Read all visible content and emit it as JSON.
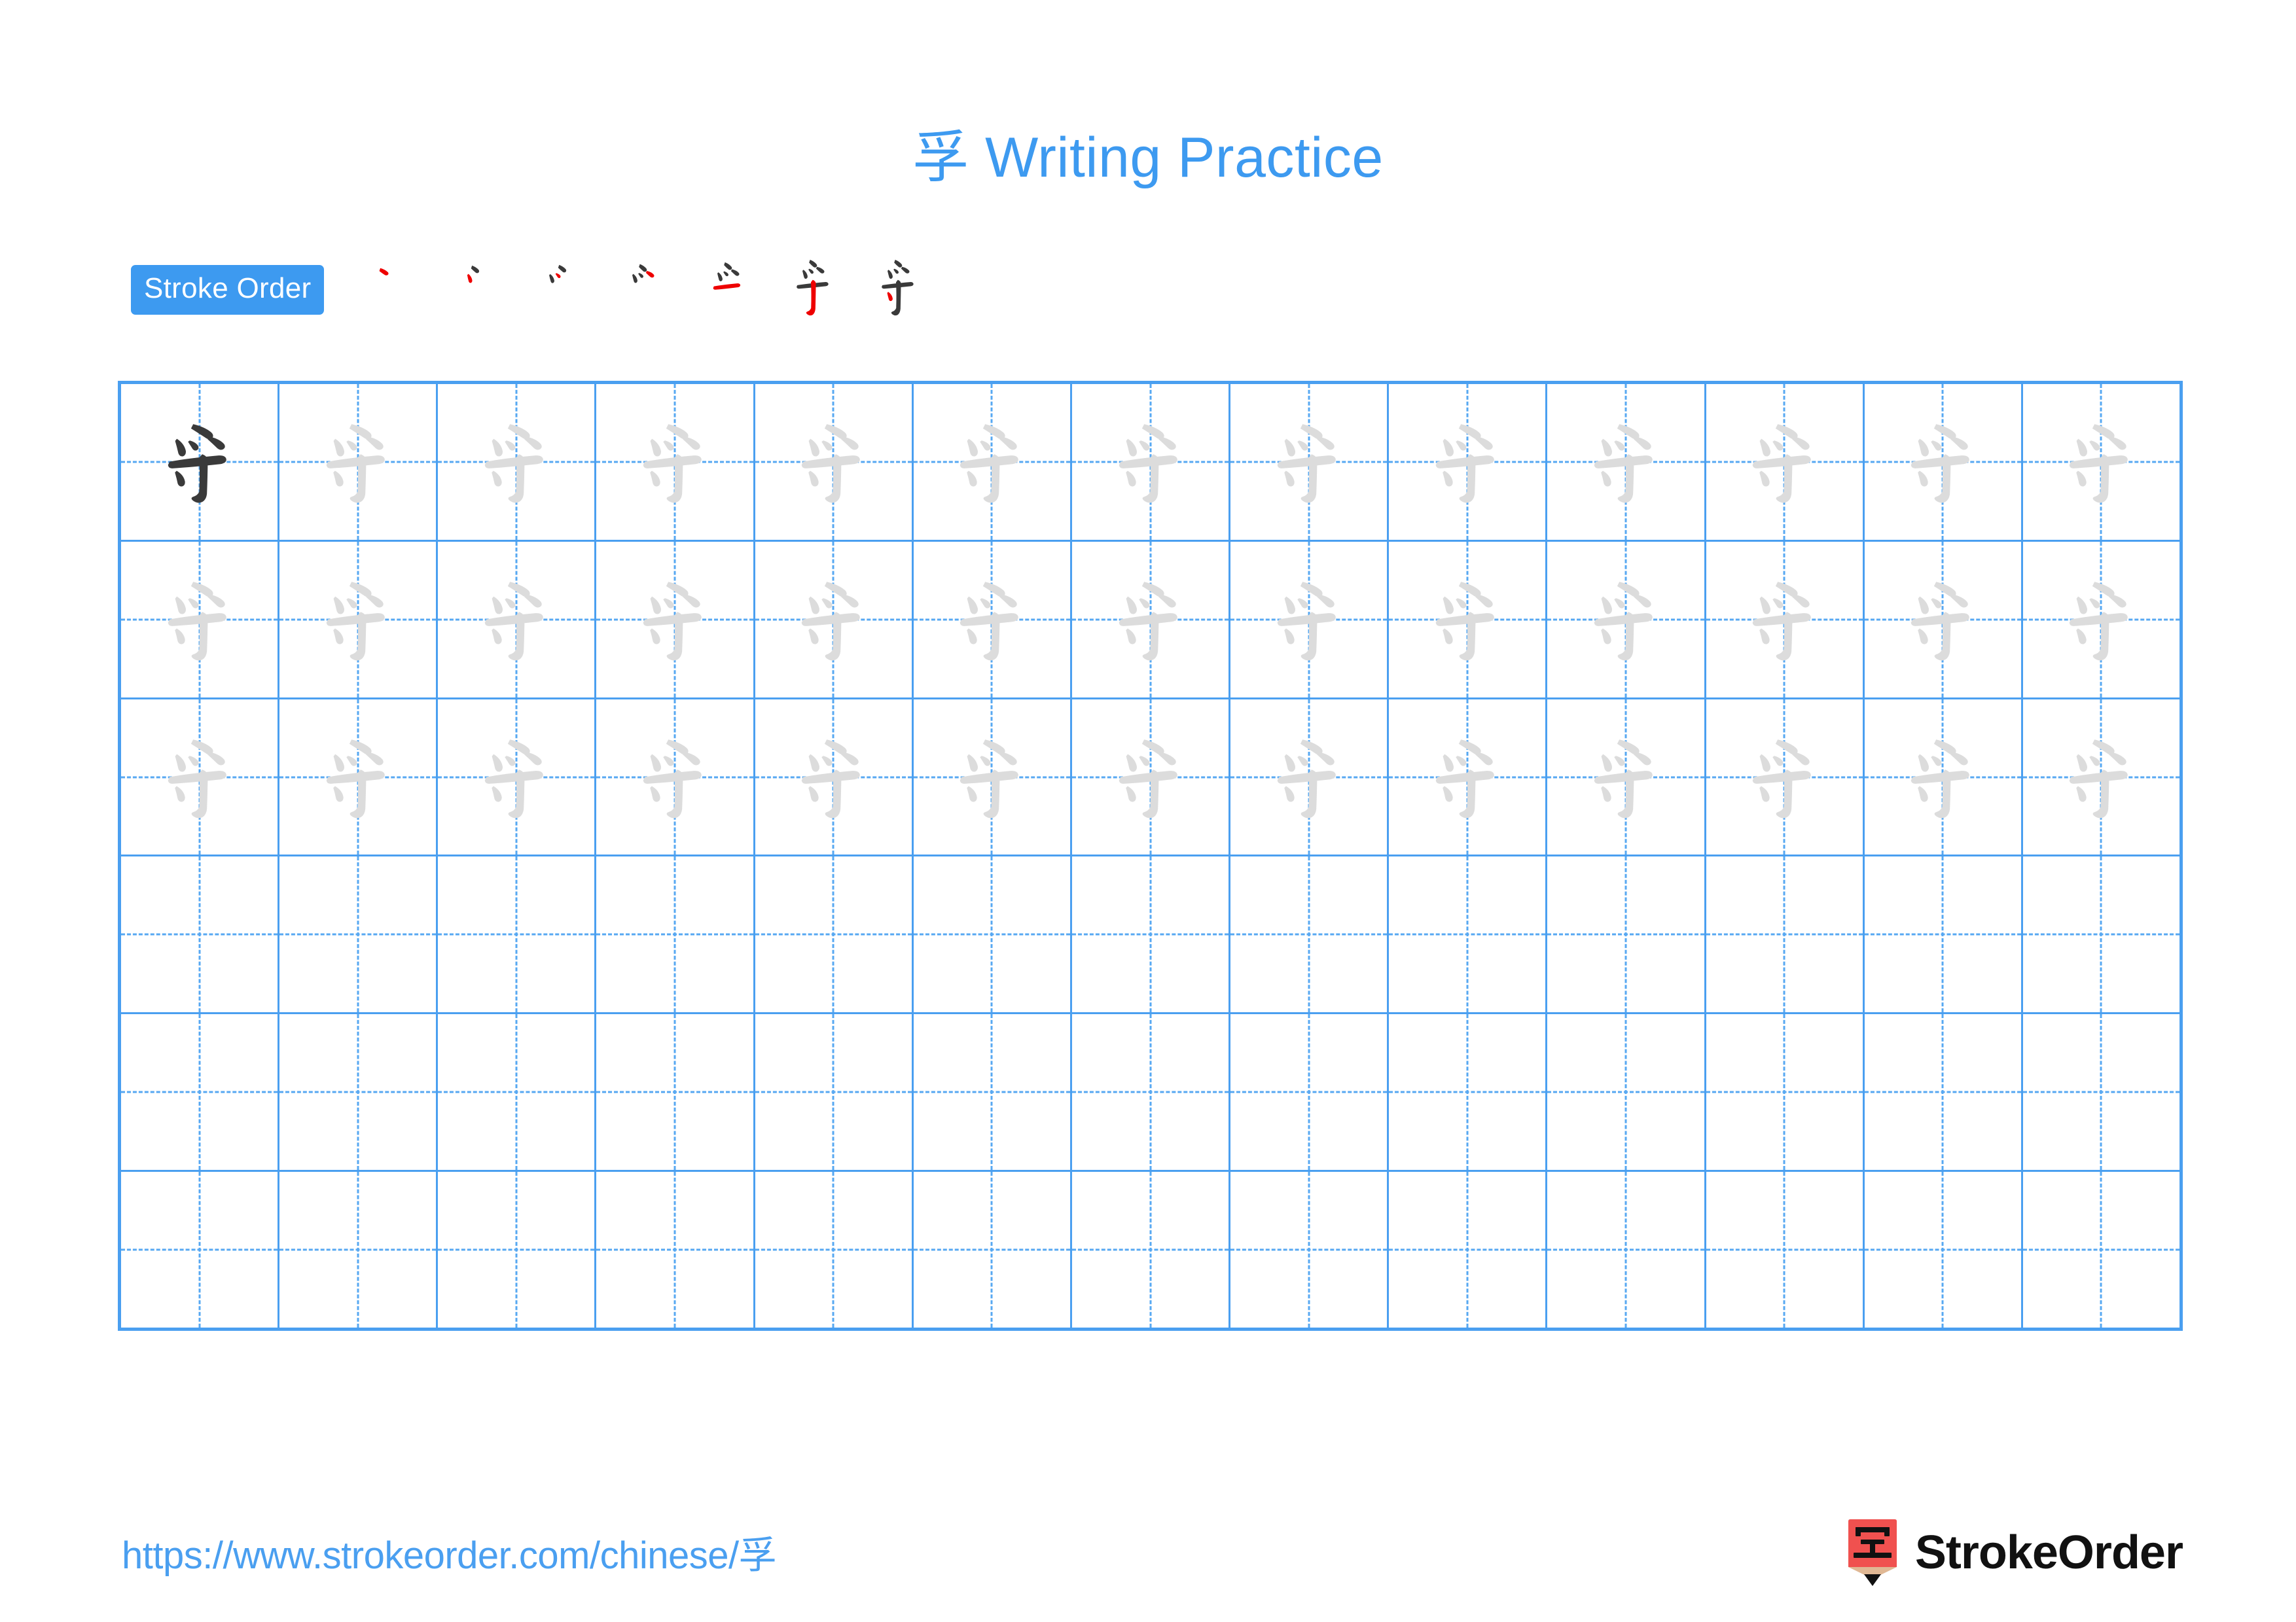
{
  "character": "孚",
  "title": {
    "character": "孚",
    "text": " Writing Practice",
    "full": "孚 Writing Practice",
    "color": "#3D9AF0"
  },
  "stroke_order": {
    "badge_label": "Stroke Order",
    "badge_bg": "#3D9AF0",
    "badge_text_color": "#ffffff",
    "total_strokes": 7,
    "existing_stroke_color": "#3A3A3A",
    "new_stroke_color": "#EE0000",
    "steps": [
      {
        "step": 1,
        "new_stroke": "dian-pie",
        "strokes_shown": 1
      },
      {
        "step": 2,
        "new_stroke": "pie",
        "strokes_shown": 2
      },
      {
        "step": 3,
        "new_stroke": "dian",
        "strokes_shown": 3
      },
      {
        "step": 4,
        "new_stroke": "dian",
        "strokes_shown": 4
      },
      {
        "step": 5,
        "new_stroke": "heng",
        "strokes_shown": 5
      },
      {
        "step": 6,
        "new_stroke": "shu-gou",
        "strokes_shown": 6
      },
      {
        "step": 7,
        "new_stroke": "dian",
        "strokes_shown": 7
      }
    ]
  },
  "grid": {
    "columns": 13,
    "rows": 6,
    "border_color": "#4A9FF0",
    "guide_color": "#57A8F2",
    "model_char_color": "#3A3A3A",
    "trace_char_color": "#DCDCDC",
    "rows_data": [
      {
        "row": 1,
        "cells": [
          "model",
          "trace",
          "trace",
          "trace",
          "trace",
          "trace",
          "trace",
          "trace",
          "trace",
          "trace",
          "trace",
          "trace",
          "trace"
        ]
      },
      {
        "row": 2,
        "cells": [
          "trace",
          "trace",
          "trace",
          "trace",
          "trace",
          "trace",
          "trace",
          "trace",
          "trace",
          "trace",
          "trace",
          "trace",
          "trace"
        ]
      },
      {
        "row": 3,
        "cells": [
          "trace",
          "trace",
          "trace",
          "trace",
          "trace",
          "trace",
          "trace",
          "trace",
          "trace",
          "trace",
          "trace",
          "trace",
          "trace"
        ]
      },
      {
        "row": 4,
        "cells": [
          "empty",
          "empty",
          "empty",
          "empty",
          "empty",
          "empty",
          "empty",
          "empty",
          "empty",
          "empty",
          "empty",
          "empty",
          "empty"
        ]
      },
      {
        "row": 5,
        "cells": [
          "empty",
          "empty",
          "empty",
          "empty",
          "empty",
          "empty",
          "empty",
          "empty",
          "empty",
          "empty",
          "empty",
          "empty",
          "empty"
        ]
      },
      {
        "row": 6,
        "cells": [
          "empty",
          "empty",
          "empty",
          "empty",
          "empty",
          "empty",
          "empty",
          "empty",
          "empty",
          "empty",
          "empty",
          "empty",
          "empty"
        ]
      }
    ]
  },
  "footer": {
    "url_prefix": "https://www.strokeorder.com/chinese/",
    "url_character": "孚",
    "url_full": "https://www.strokeorder.com/chinese/孚",
    "url_color": "#4A9FF0",
    "brand_name": "StrokeOrder",
    "brand_mark_char": "字",
    "brand_mark_bg": "#F0514F",
    "brand_mark_tip": "#E0B894",
    "brand_mark_point": "#111111"
  }
}
